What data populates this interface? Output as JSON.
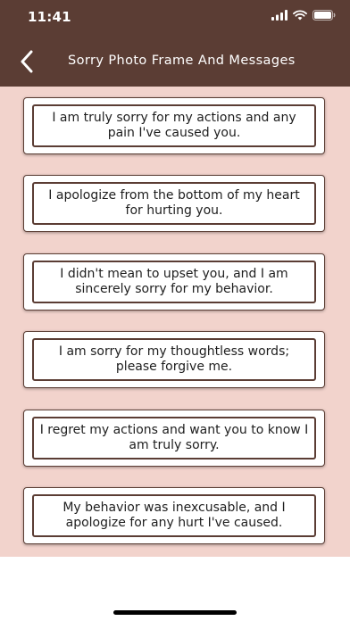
{
  "status_bar": {
    "time": "11:41",
    "icons": [
      "signal-icon",
      "wifi-icon",
      "battery-icon"
    ]
  },
  "nav": {
    "back_icon": "chevron-left-icon",
    "title": "Sorry Photo Frame And Messages"
  },
  "messages": [
    "I am truly sorry for my actions and any pain I've caused you.",
    "I apologize from the bottom of my heart for hurting you.",
    "I didn't mean to upset you, and I am sincerely sorry for my behavior.",
    "I am sorry for my thoughtless words; please forgive me.",
    "I regret my actions and want you to know I am truly sorry.",
    "My behavior was inexcusable, and I apologize for any hurt I've caused."
  ],
  "colors": {
    "header_bg": "#5b3d34",
    "content_bg": "#f2d3cc",
    "card_bg": "#ffffff",
    "card_border": "#5b3d34",
    "text": "#1e1e1e"
  }
}
